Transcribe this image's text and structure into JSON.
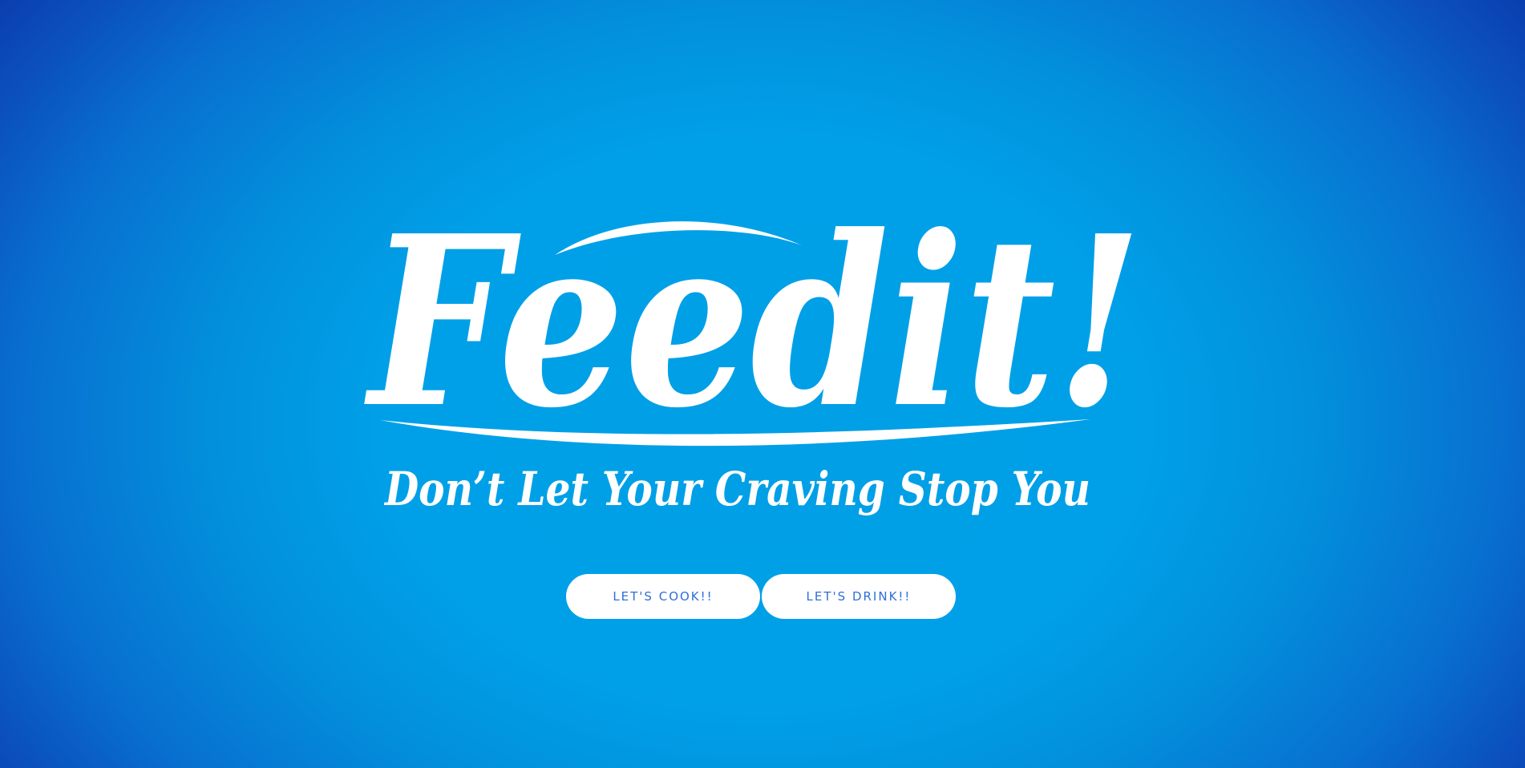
{
  "brand": {
    "name": "Feedit!",
    "tagline": "Don’t Let Your Craving Stop You"
  },
  "actions": {
    "cook_label": "LET'S COOK!!",
    "drink_label": "LET'S DRINK!!"
  },
  "colors": {
    "background_center": "#00a0e8",
    "background_edge": "#0b3fb0",
    "logo": "#ffffff",
    "button_bg": "#ffffff",
    "button_text": "#2f6fd8"
  }
}
